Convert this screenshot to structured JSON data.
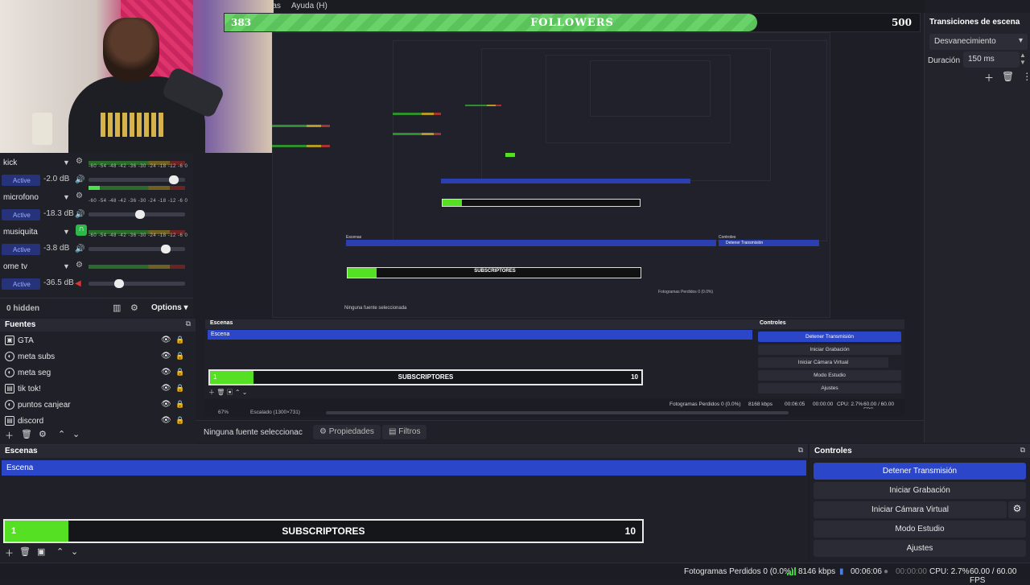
{
  "menubar": {
    "item_fragment": "ntas",
    "help": "Ayuda (H)"
  },
  "followers_bar": {
    "start": "383",
    "title": "FOLLOWERS",
    "end": "500",
    "progress_fraction": 0.766,
    "fill_color": "#69d36a"
  },
  "transitions": {
    "title": "Transiciones de escena",
    "type": "Desvanecimiento",
    "duration_label": "Duración",
    "duration_value": "150 ms"
  },
  "mixer": {
    "channels": [
      {
        "name": "kick",
        "status": "Active",
        "db": "-2.0 dB",
        "level": 0.93,
        "meter": 0.12
      },
      {
        "name": "microfono",
        "status": "Active",
        "db": "-18.3 dB",
        "level": 0.58,
        "meter": 0
      },
      {
        "name": "musiquita",
        "status": "Active",
        "db": "-3.8 dB",
        "level": 0.85,
        "meter": 0
      },
      {
        "name": "ome tv",
        "status": "Active",
        "db": "-36.5 dB",
        "level": 0.37,
        "meter": 0
      }
    ],
    "scale": "-60 -54 -48 -42 -36 -30 -24 -18 -12 -6 0",
    "hidden": "0 hidden",
    "options": "Options"
  },
  "sources": {
    "title": "Fuentes",
    "items": [
      "GTA",
      "meta subs",
      "meta seg",
      "tik tok!",
      "puntos canjear",
      "discord"
    ]
  },
  "nested_preview": {
    "scenes_title": "Escenas",
    "scene": "Escena",
    "sub_start": "1",
    "sub_title": "SUBSCRIPTORES",
    "sub_end": "10",
    "controls_title": "Controles",
    "controls": [
      "Detener Transmisión",
      "Iniciar Grabación",
      "Iniciar Cámara Virtual",
      "Modo Estudio",
      "Ajustes"
    ],
    "status": "Fotogramas Perdidos 0 (0.0%)",
    "kbps": "8168 kbps",
    "time": "00:06:05",
    "rec": "00:00:00",
    "cpu": "CPU: 2.7%",
    "fps": "60.00 / 60.00 FPS",
    "zoom": "67%",
    "scaled": "Escalado (1300×731)",
    "no_source": "Ninguna fuente seleccionada",
    "props": "Propiedades",
    "filters": "Filtros"
  },
  "no_source_bar": {
    "label": "Ninguna fuente seleccionac",
    "props": "Propiedades",
    "filters": "Filtros"
  },
  "scenes": {
    "title": "Escenas",
    "active": "Escena"
  },
  "subscribers_bar": {
    "start": "1",
    "title": "SUBSCRIPTORES",
    "end": "10",
    "progress_fraction": 0.1,
    "fill_color": "#55e024"
  },
  "controls": {
    "title": "Controles",
    "stop_stream": "Detener Transmisión",
    "start_recording": "Iniciar Grabación",
    "start_vcam": "Iniciar Cámara Virtual",
    "studio_mode": "Modo Estudio",
    "settings": "Ajustes"
  },
  "statusbar": {
    "dropped": "Fotogramas Perdidos 0 (0.0%)",
    "kbps": "8146 kbps",
    "stream_time": "00:06:06",
    "rec_time": "00:00:00",
    "cpu": "CPU: 2.7%",
    "fps": "60.00 / 60.00 FPS"
  },
  "colors": {
    "accent": "#2b46c8",
    "panel": "#1f2028",
    "green": "#55e024"
  }
}
